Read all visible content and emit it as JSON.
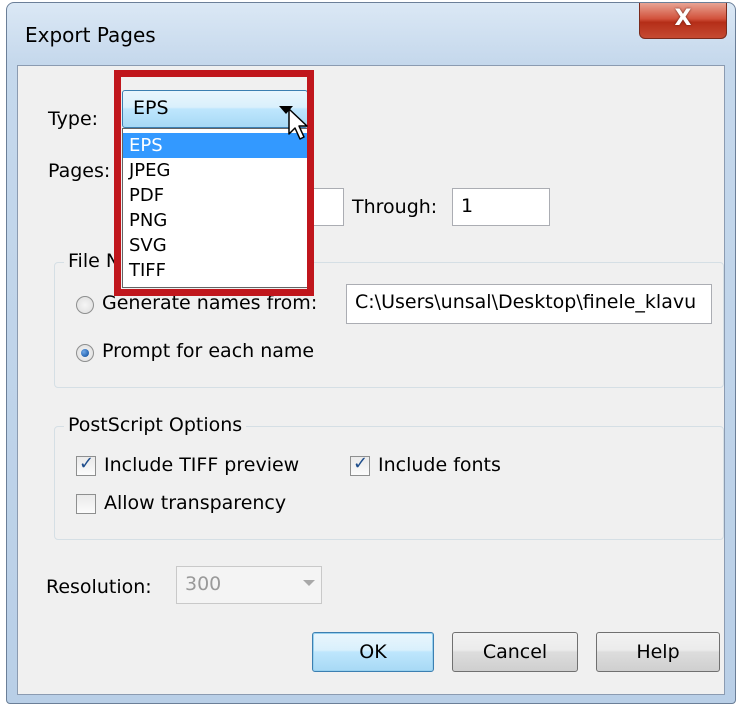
{
  "window": {
    "title": "Export Pages",
    "close_glyph": "X"
  },
  "type": {
    "label": "Type:",
    "value": "EPS",
    "options": [
      "EPS",
      "JPEG",
      "PDF",
      "PNG",
      "SVG",
      "TIFF"
    ],
    "selected_index": 0
  },
  "pages": {
    "label": "Pages:",
    "through_label": "Through:",
    "through_value": "1"
  },
  "file_names": {
    "legend": "File N",
    "generate_label": "Generate names from:",
    "generate_value": "C:\\Users\\unsal\\Desktop\\finele_klavu",
    "prompt_label": "Prompt for each name",
    "selected": "prompt"
  },
  "postscript": {
    "legend": "PostScript Options",
    "include_tiff_label": "Include TIFF preview",
    "include_tiff_checked": true,
    "include_fonts_label": "Include fonts",
    "include_fonts_checked": true,
    "allow_transparency_label": "Allow transparency",
    "allow_transparency_checked": false
  },
  "resolution": {
    "label": "Resolution:",
    "value": "300"
  },
  "buttons": {
    "ok": "OK",
    "cancel": "Cancel",
    "help": "Help"
  },
  "colors": {
    "highlight": "#c0161c",
    "selection": "#3399ff"
  }
}
